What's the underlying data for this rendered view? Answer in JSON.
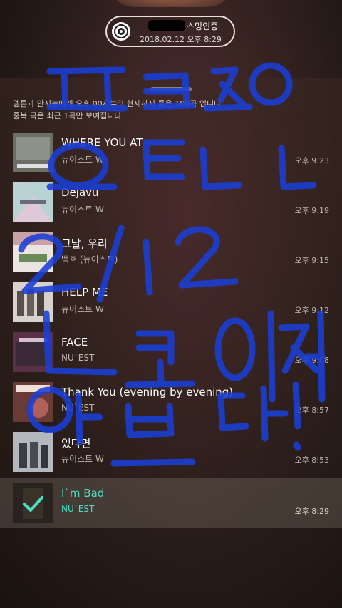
{
  "auth": {
    "title": "스밍인증",
    "datetime": "2018.02.12 오후 8:29"
  },
  "notice": {
    "line1": "멜론과 안지능에게 오후 00시부터 현재까지 들은 100곡 입니다.",
    "line2": "중복 곡은 최근 1곡만 보여집니다."
  },
  "tracks": [
    {
      "title": "WHERE YOU AT",
      "artist": "뉴이스트 W",
      "time": "오후 9:23",
      "art_color": "#6b6f66"
    },
    {
      "title": "Dejavu",
      "artist": "뉴이스트 W",
      "time": "오후 9:19",
      "art_color": "#a9c6c9"
    },
    {
      "title": "그날, 우리",
      "artist": "백호 (뉴이스트)",
      "time": "오후 9:15",
      "art_color": "#c9b6b8"
    },
    {
      "title": "HELP ME",
      "artist": "뉴이스트 W",
      "time": "오후 9:12",
      "art_color": "#c9c2bc"
    },
    {
      "title": "FACE",
      "artist": "NU`EST",
      "time": "오후 9:08",
      "art_color": "#6a3d55"
    },
    {
      "title": "Thank You (evening by evening)",
      "artist": "NU`EST",
      "time": "오후 8:57",
      "art_color": "#7a4a40"
    },
    {
      "title": "있다면",
      "artist": "뉴이스트 W",
      "time": "오후 8:53",
      "art_color": "#9aa0a8"
    },
    {
      "title": "I`m Bad",
      "artist": "NU`EST",
      "time": "오후 8:29",
      "art_color": "#4a4038",
      "selected": true
    }
  ],
  "handwriting": [
    "프로듀스 101",
    "ㅇㅌㄴㄴ",
    "2/12",
    "나도이제",
    "어쁘다!"
  ],
  "colors": {
    "accent": "#4be0c4",
    "ink": "#1a3fd6"
  },
  "icons": {
    "auth": "disc-icon",
    "selected": "check-icon"
  }
}
